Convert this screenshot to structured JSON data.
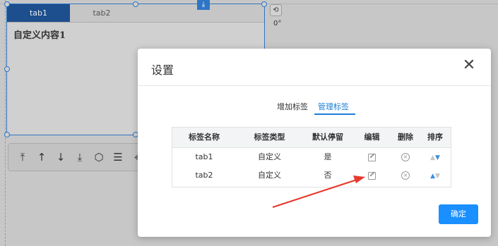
{
  "canvas": {
    "tabs": [
      "tab1",
      "tab2"
    ],
    "content_text": "自定义内容1",
    "rotate_icon": "rotate-icon",
    "angle_text": "0°",
    "download_icon": "download-icon",
    "toolbar_icons": [
      "move-top-icon",
      "move-up-icon",
      "move-down-icon",
      "move-bottom-icon",
      "settings-hex-icon",
      "filter-icon",
      "component-icon"
    ]
  },
  "modal": {
    "title": "设置",
    "close_icon": "close-icon",
    "tabs": [
      {
        "label": "增加标签",
        "active": false
      },
      {
        "label": "管理标签",
        "active": true
      }
    ],
    "table": {
      "headers": [
        "标签名称",
        "标签类型",
        "默认停留",
        "编辑",
        "删除",
        "排序"
      ],
      "rows": [
        {
          "name": "tab1",
          "type": "自定义",
          "default": "是"
        },
        {
          "name": "tab2",
          "type": "自定义",
          "default": "否"
        }
      ]
    },
    "confirm_label": "确定"
  },
  "colors": {
    "accent": "#1a8fff",
    "active_tab_bg": "#1d4e8d",
    "selection_border": "#2f75c6",
    "annotation_arrow": "#e8392e"
  }
}
